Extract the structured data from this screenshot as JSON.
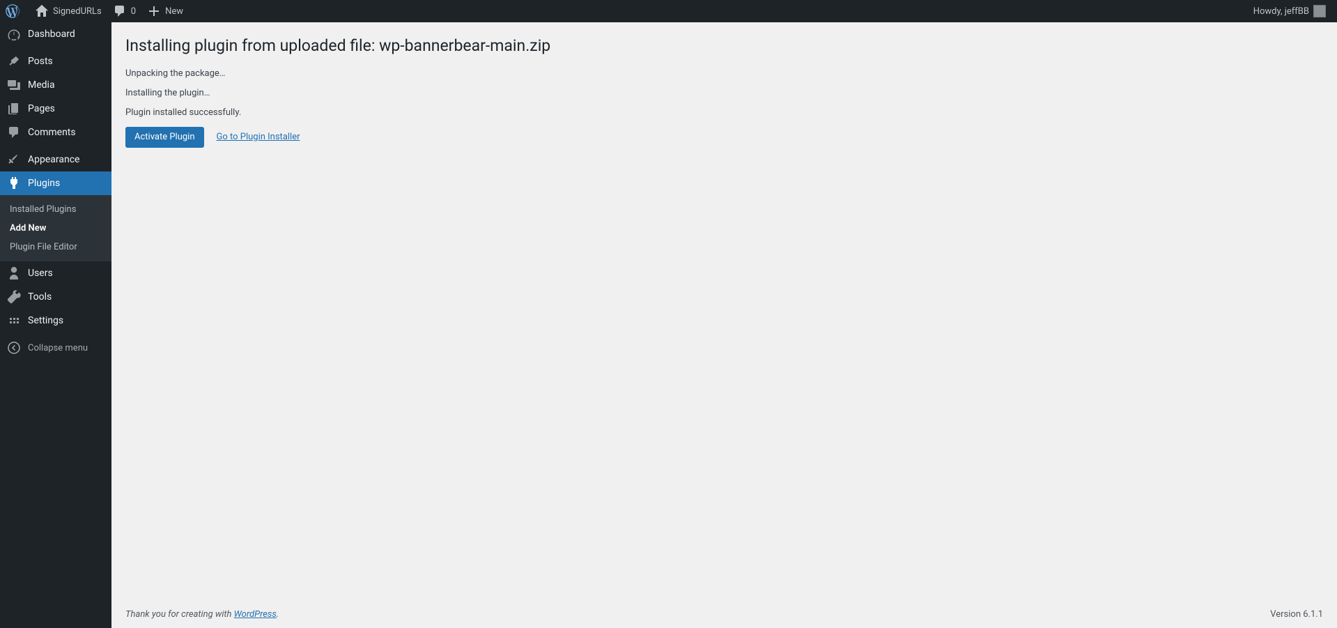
{
  "topbar": {
    "site_name": "SignedURLs",
    "comments_count": "0",
    "new_label": "New",
    "howdy": "Howdy, jeffBB"
  },
  "sidebar": {
    "dashboard": "Dashboard",
    "posts": "Posts",
    "media": "Media",
    "pages": "Pages",
    "comments": "Comments",
    "appearance": "Appearance",
    "plugins": "Plugins",
    "users": "Users",
    "tools": "Tools",
    "settings": "Settings",
    "collapse": "Collapse menu",
    "submenu": {
      "installed": "Installed Plugins",
      "add_new": "Add New",
      "editor": "Plugin File Editor"
    }
  },
  "main": {
    "title": "Installing plugin from uploaded file: wp-bannerbear-main.zip",
    "status1": "Unpacking the package…",
    "status2": "Installing the plugin…",
    "status3": "Plugin installed successfully.",
    "activate_label": "Activate Plugin",
    "go_installer_label": "Go to Plugin Installer"
  },
  "footer": {
    "thanks_prefix": "Thank you for creating with ",
    "thanks_link": "WordPress",
    "thanks_suffix": ".",
    "version": "Version 6.1.1"
  }
}
